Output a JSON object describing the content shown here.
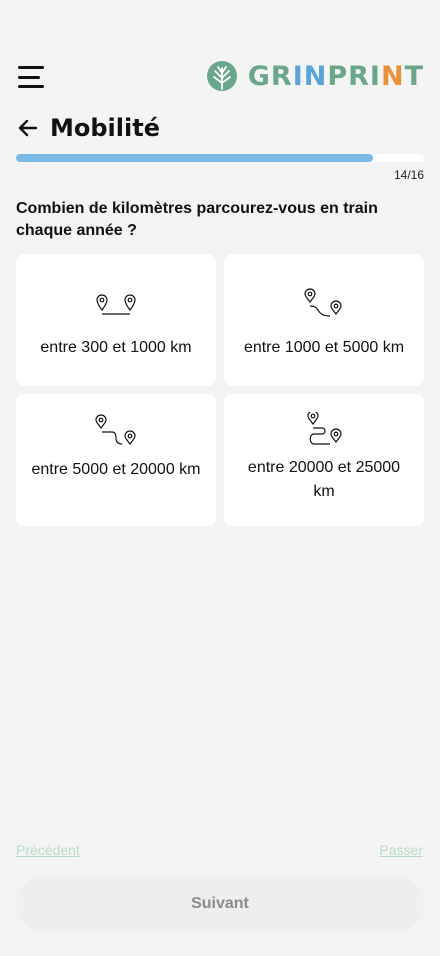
{
  "header": {
    "brand": {
      "part1": "GR",
      "part2": "IN",
      "part3": "PRI",
      "part4": "N",
      "part5": "T"
    },
    "icons": {
      "menu": "hamburger-menu-icon",
      "logo": "tree-leaf-logo-icon",
      "back": "arrow-left-icon"
    }
  },
  "page": {
    "title": "Mobilité"
  },
  "progress": {
    "current": 14,
    "total": 16,
    "label": "14/16",
    "fraction": 0.875,
    "color": "#7ab8e6"
  },
  "question": "Combien de kilomètres parcourez-vous en train chaque année ?",
  "options": [
    {
      "label": "entre 300 et 1000 km",
      "icon": "two-pins-straight-icon"
    },
    {
      "label": "entre 1000 et 5000 km",
      "icon": "two-pins-curve-icon"
    },
    {
      "label": "entre 5000 et 20000 km",
      "icon": "two-pins-wave-icon"
    },
    {
      "label": "entre 20000 et 25000 km",
      "icon": "two-pins-loop-icon"
    }
  ],
  "footer": {
    "prev": "Précédent",
    "skip": "Passer",
    "next": "Suivant"
  },
  "colors": {
    "background": "#f4f4f4",
    "brand_green": "#6aa68a",
    "brand_blue": "#5aa5d6",
    "brand_orange": "#e8903a",
    "link_muted": "#b7dcc6"
  }
}
